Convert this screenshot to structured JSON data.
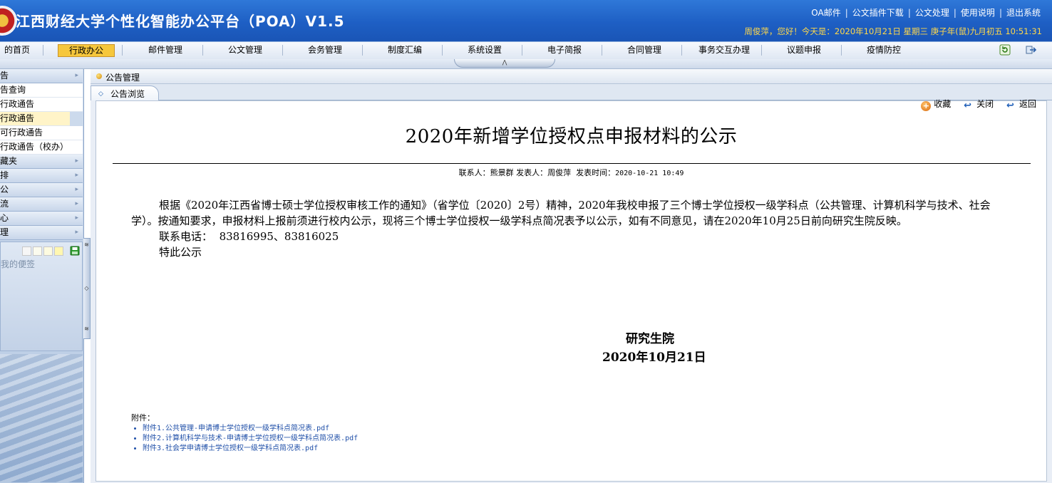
{
  "header": {
    "title": "江西财经大学个性化智能办公平台（POA）V1.5",
    "links": [
      "OA邮件",
      "公文插件下载",
      "公文处理",
      "使用说明",
      "退出系统"
    ],
    "status": "周俊萍，您好！今天是：2020年10月21日 星期三 庚子年(鼠)九月初五 10:51:31"
  },
  "menu": {
    "items": [
      "的首页",
      "行政办公",
      "邮件管理",
      "公文管理",
      "会务管理",
      "制度汇编",
      "系统设置",
      "电子简报",
      "合同管理",
      "事务交互办理",
      "议题申报",
      "疫情防控"
    ],
    "active_index": 1
  },
  "sidebar": {
    "rows": [
      {
        "label": "告",
        "kind": "cat"
      },
      {
        "label": "告查询",
        "kind": "sub"
      },
      {
        "label": "行政通告",
        "kind": "sub"
      },
      {
        "label": "行政通告",
        "kind": "sub",
        "selected": true
      },
      {
        "label": "可行政通告",
        "kind": "sub"
      },
      {
        "label": "行政通告（校办）",
        "kind": "sub"
      },
      {
        "label": "藏夹",
        "kind": "cat"
      },
      {
        "label": "排",
        "kind": "cat"
      },
      {
        "label": "公",
        "kind": "cat"
      },
      {
        "label": "流",
        "kind": "cat"
      },
      {
        "label": "心",
        "kind": "cat"
      },
      {
        "label": "理",
        "kind": "cat"
      }
    ],
    "note_text": "我的便签"
  },
  "main": {
    "module_title": "公告管理",
    "tab_label": "公告浏览",
    "toolbar": {
      "favorite": "收藏",
      "close": "关闭",
      "back": "返回"
    },
    "doc": {
      "title": "2020年新增学位授权点申报材料的公示",
      "meta_contact_label": "联系人：",
      "meta_contact": "熊景群",
      "meta_publisher_label": "发表人：",
      "meta_publisher": "周俊萍",
      "meta_time_label": "发表时间：",
      "meta_time": "2020-10-21 10:49",
      "paragraph": "根据《2020年江西省博士硕士学位授权审核工作的通知》（省学位〔2020〕2号）精神，2020年我校申报了三个博士学位授权一级学科点（公共管理、计算机科学与技术、社会学）。按通知要求，申报材料上报前须进行校内公示，现将三个博士学位授权一级学科点简况表予以公示，如有不同意见，请在2020年10月25日前向研究生院反映。",
      "phone_label": "联系电话：",
      "phone": "83816995、83816025",
      "closing": "特此公示",
      "signature_org": "研究生院",
      "signature_date": "2020年10月21日",
      "attachments_label": "附件：",
      "attachments": [
        "附件1.公共管理-申请博士学位授权一级学科点简况表.pdf",
        "附件2.计算机科学与技术-申请博士学位授权一级学科点简况表.pdf",
        "附件3.社会学申请博士学位授权一级学科点简况表.pdf"
      ]
    }
  },
  "colors": {
    "header_blue": "#1e5fc4",
    "status_yellow": "#ffd84a",
    "active_menu": "#f6c73c",
    "link_blue": "#1f4fa8"
  },
  "icons": {
    "logo": "university-seal",
    "refresh": "refresh-icon",
    "exit": "exit-icon",
    "favorite": "favorite-plus-icon",
    "close": "back-arrow-icon",
    "back": "back-arrow-icon"
  }
}
